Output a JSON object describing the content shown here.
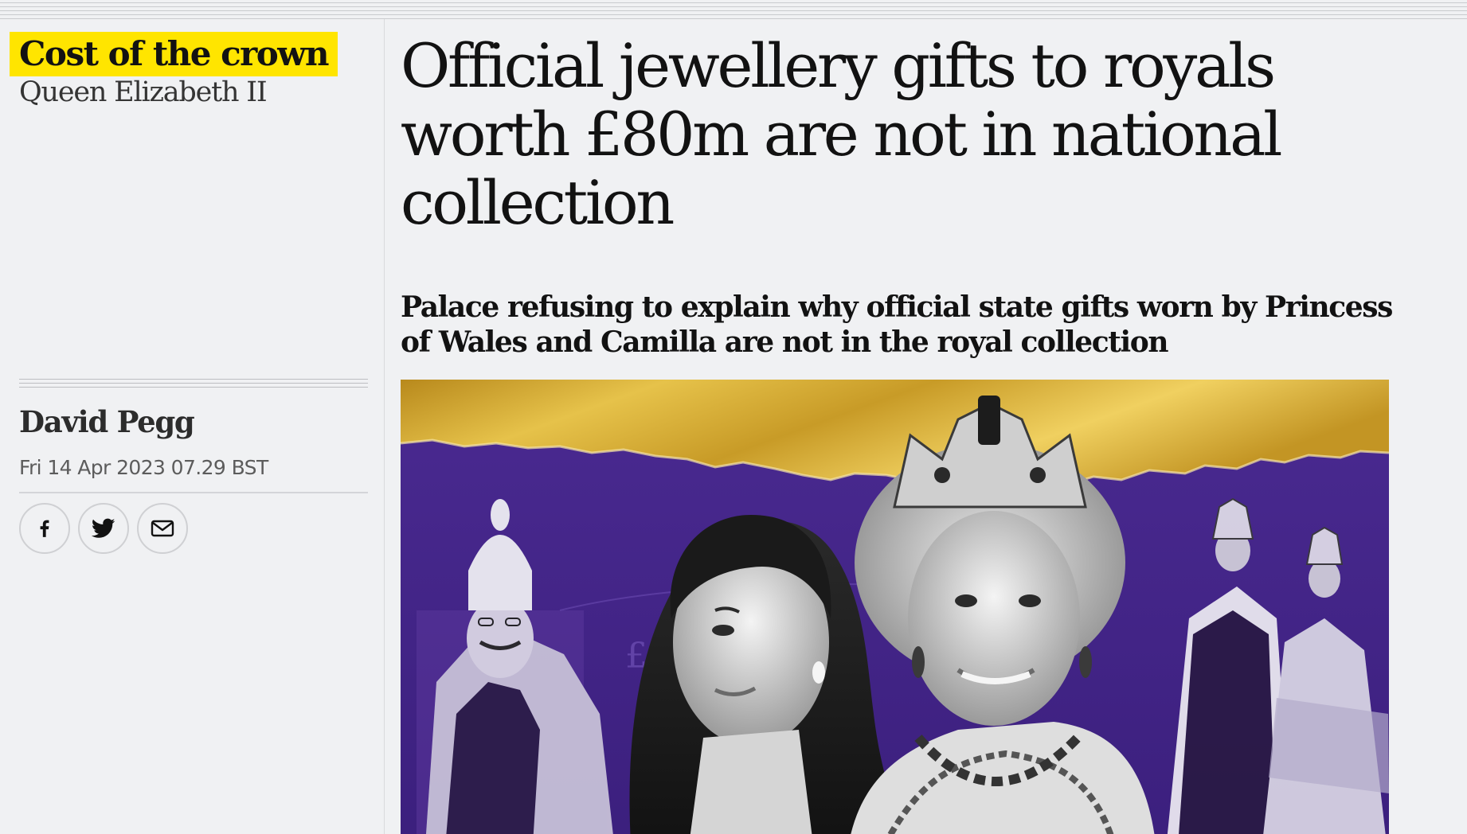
{
  "series": {
    "kicker": "Cost of the crown",
    "subtitle": "Queen Elizabeth II",
    "kicker_color": "#ffe500"
  },
  "article": {
    "headline": "Official jewellery gifts to royals worth £80m are not in national collection",
    "standfirst": "Palace refusing to explain why official state gifts worn by Princess of Wales and Camilla are not in the royal collection",
    "byline": "David Pegg",
    "dateline": "Fri 14 Apr 2023 07.29 BST"
  },
  "share": {
    "buttons": [
      {
        "icon": "facebook-icon"
      },
      {
        "icon": "twitter-icon"
      },
      {
        "icon": "email-icon"
      }
    ]
  },
  "hero_image": {
    "palette": {
      "gold": "#c9a22c",
      "purple": "#4a2a91"
    },
    "pound_sign": "£"
  }
}
